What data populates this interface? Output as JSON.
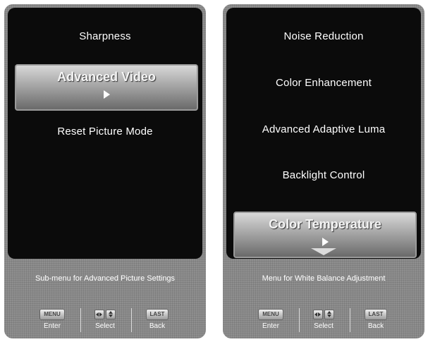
{
  "left_panel": {
    "items": [
      "Sharpness",
      "Reset Picture Mode"
    ],
    "selected": "Advanced Video",
    "hint": "Sub-menu for Advanced Picture Settings"
  },
  "right_panel": {
    "items": [
      "Noise Reduction",
      "Color Enhancement",
      "Advanced Adaptive Luma",
      "Backlight Control"
    ],
    "selected": "Color Temperature",
    "hint": "Menu for White Balance Adjustment"
  },
  "buttons": {
    "menu_key": "MENU",
    "enter_label": "Enter",
    "select_label": "Select",
    "last_key": "LAST",
    "back_label": "Back"
  }
}
